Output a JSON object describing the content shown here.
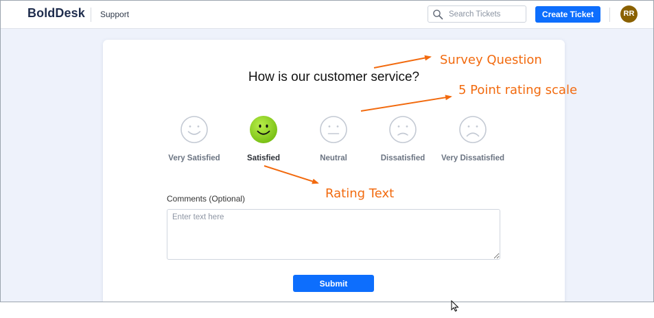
{
  "header": {
    "logo": "BoldDesk",
    "section": "Support",
    "search_placeholder": "Search Tickets",
    "create_ticket_label": "Create Ticket",
    "avatar_initials": "RR"
  },
  "survey": {
    "question": "How is our customer service?",
    "ratings": [
      {
        "label": "Very Satisfied",
        "icon": "very-satisfied-face-icon",
        "selected": false
      },
      {
        "label": "Satisfied",
        "icon": "satisfied-face-icon",
        "selected": true
      },
      {
        "label": "Neutral",
        "icon": "neutral-face-icon",
        "selected": false
      },
      {
        "label": "Dissatisfied",
        "icon": "dissatisfied-face-icon",
        "selected": false
      },
      {
        "label": "Very Dissatisfied",
        "icon": "very-dissatisfied-face-icon",
        "selected": false
      }
    ],
    "comments_label": "Comments (Optional)",
    "comments_placeholder": "Enter text here",
    "comments_value": "",
    "submit_label": "Submit"
  },
  "annotations": {
    "survey_question": "Survey Question",
    "rating_scale": "5 Point rating scale",
    "rating_text": "Rating Text"
  },
  "colors": {
    "primary": "#0d6efd",
    "brand_text": "#1f2d4d",
    "avatar": "#8a6100",
    "selected_face": "#8fd21a",
    "annotation": "#f26a0e",
    "page_background": "#eef2fb"
  }
}
